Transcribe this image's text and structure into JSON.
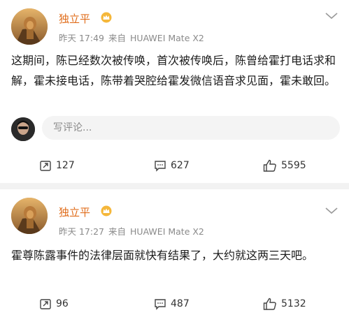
{
  "posts": [
    {
      "author": "独立平",
      "time": "昨天 17:49",
      "source_prefix": "来自",
      "source": "HUAWEI Mate X2",
      "content": "这期间，陈已经数次被传唤，首次被传唤后，陈曾给霍打电话求和解，霍未接电话，陈带着哭腔给霍发微信语音求见面，霍未敢回。",
      "comment_placeholder": "写评论...",
      "reposts": "127",
      "comments": "627",
      "likes": "5595"
    },
    {
      "author": "独立平",
      "time": "昨天 17:27",
      "source_prefix": "来自",
      "source": "HUAWEI Mate X2",
      "content": "霍尊陈露事件的法律层面就快有结果了，大约就这两三天吧。",
      "reposts": "96",
      "comments": "487",
      "likes": "5132"
    }
  ],
  "icons": {
    "crown": "crown-badge-icon",
    "more": "chevron-down-icon",
    "repost": "repost-icon",
    "comment": "comment-icon",
    "like": "thumbs-up-icon"
  },
  "colors": {
    "author": "#e06c1a",
    "meta": "#8a8a8a",
    "divider": "#f2f2f2"
  }
}
